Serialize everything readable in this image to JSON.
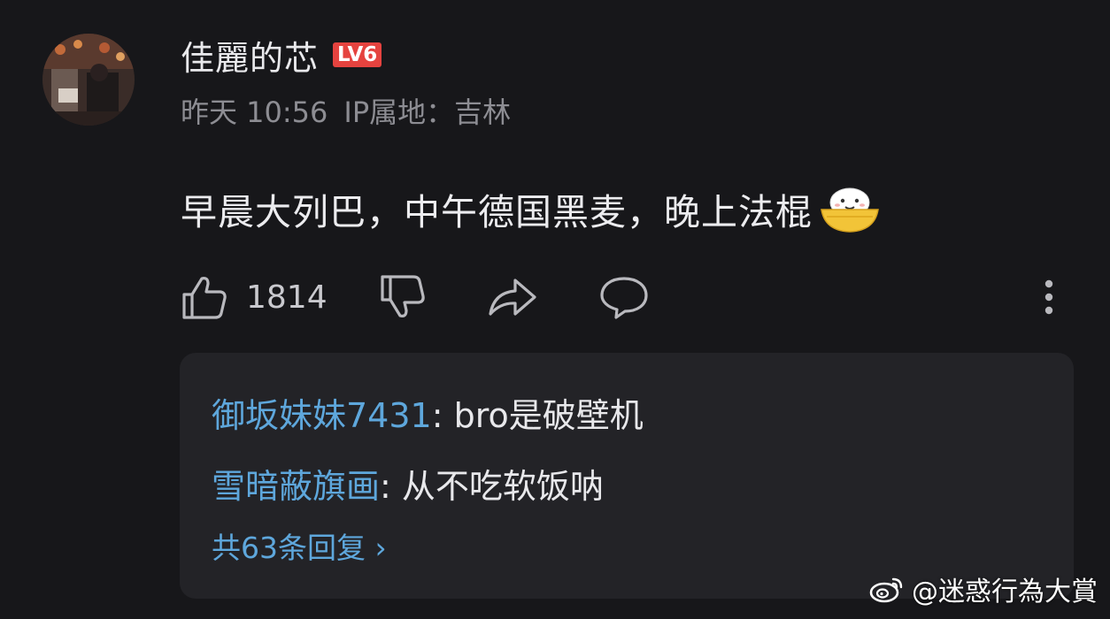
{
  "comment": {
    "author": "佳麗的芯",
    "level": "LV6",
    "time": "昨天 10:56",
    "ip_location": "IP属地：吉林",
    "text": "早晨大列巴，中午德国黑麦，晚上法棍",
    "emoji": "rice-bowl-emoji"
  },
  "actions": {
    "like_count": "1814",
    "icons": [
      "thumbs-up-icon",
      "thumbs-down-icon",
      "share-icon",
      "comment-bubble-icon",
      "more-vertical-icon"
    ]
  },
  "replies": {
    "items": [
      {
        "name": "御坂妹妹7431",
        "separator": ": ",
        "text": "bro是破壁机"
      },
      {
        "name": "雪暗蔽旗画",
        "separator": ": ",
        "text": "从不吃软饭呐"
      }
    ],
    "more_label": "共63条回复 ›"
  },
  "watermark": {
    "text": "@迷惑行為大賞",
    "icon": "weibo-icon"
  },
  "colors": {
    "background": "#17171a",
    "reply_panel": "#232327",
    "link_blue": "#5ea7dc",
    "level_badge": "#e5433f",
    "meta_gray": "#8d8d93"
  }
}
